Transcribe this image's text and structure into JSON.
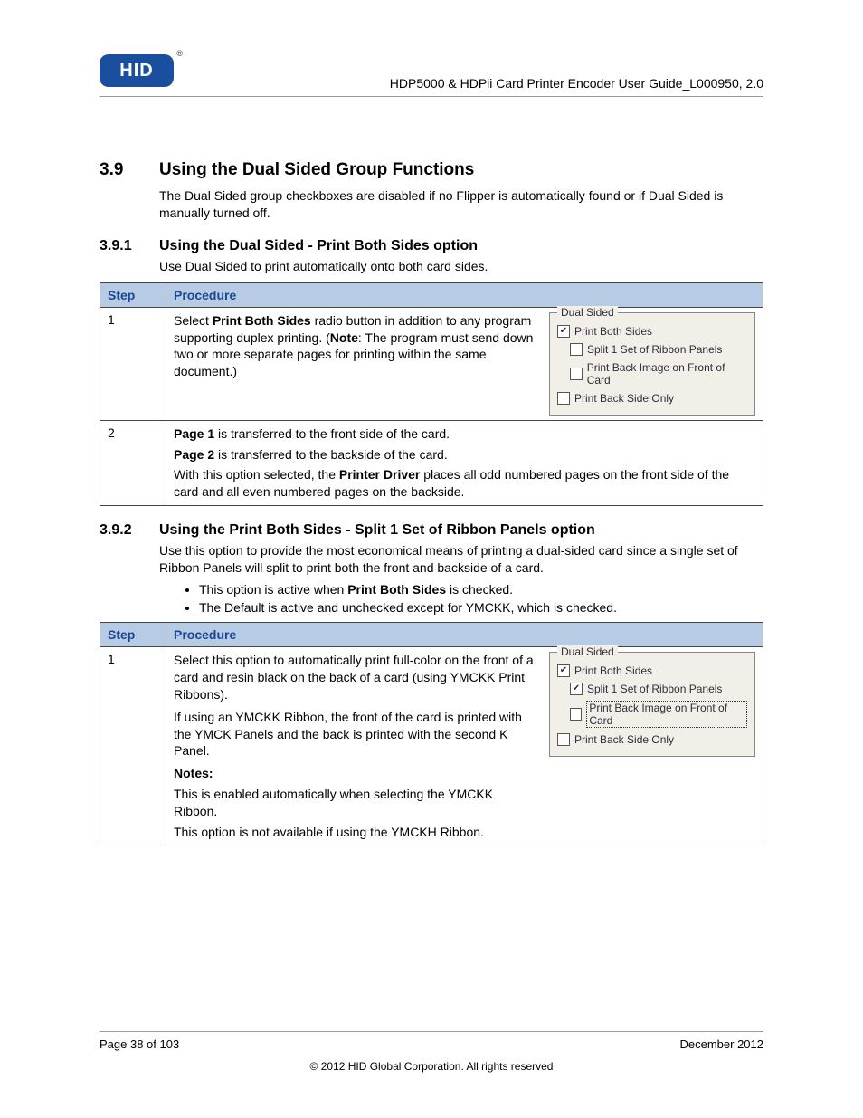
{
  "header": {
    "logo_text": "HID",
    "reg": "®",
    "doc_title": "HDP5000 & HDPii Card Printer Encoder User Guide_L000950, 2.0"
  },
  "section_39": {
    "num": "3.9",
    "title": "Using the Dual Sided Group Functions",
    "intro": "The Dual Sided group checkboxes are disabled if no Flipper is automatically found or if Dual Sided is manually turned off."
  },
  "section_391": {
    "num": "3.9.1",
    "title": "Using the Dual Sided - Print Both Sides option",
    "intro": "Use Dual Sided to print automatically onto both card sides.",
    "headers": {
      "step": "Step",
      "procedure": "Procedure"
    },
    "row1": {
      "step": "1",
      "text_pre": "Select ",
      "text_bold1": "Print Both Sides",
      "text_mid1": " radio button in addition to any program supporting duplex printing. (",
      "text_bold2": "Note",
      "text_mid2": ":  The program must send down two or more separate pages for printing within the same document.)"
    },
    "gb1": {
      "legend": "Dual Sided",
      "opt1": "Print Both Sides",
      "opt2": "Split 1 Set of Ribbon Panels",
      "opt3": "Print Back Image on Front of Card",
      "opt4": "Print Back Side Only"
    },
    "row2": {
      "step": "2",
      "line1_b": "Page 1",
      "line1_t": " is transferred to the front side of the card.",
      "line2_b": "Page 2",
      "line2_t": " is transferred to the backside of the card.",
      "line3_a": "With this option selected, the ",
      "line3_b": "Printer Driver",
      "line3_c": " places all odd numbered pages on the front side of the card and all even numbered pages on the backside."
    }
  },
  "section_392": {
    "num": "3.9.2",
    "title": "Using the Print Both Sides - Split 1 Set of Ribbon Panels option",
    "intro": "Use this option to provide the most economical means of printing a dual-sided card since a single set of Ribbon Panels will split to print both the front and backside of a card.",
    "bullet1_a": "This option is active when ",
    "bullet1_b": "Print Both Sides",
    "bullet1_c": " is checked.",
    "bullet2": "The Default is active and unchecked except for YMCKK, which is checked.",
    "headers": {
      "step": "Step",
      "procedure": "Procedure"
    },
    "row1": {
      "step": "1",
      "p1": "Select this option to automatically print full-color on the front of a card and resin black on the back of a card (using YMCKK Print Ribbons).",
      "p2": "If using an YMCKK Ribbon, the front of the card is printed with the YMCK Panels and the back is printed with the second K Panel.",
      "notes_label": "Notes:",
      "n1": "This is enabled automatically when selecting the YMCKK Ribbon.",
      "n2": "This option is not available if using the YMCKH Ribbon."
    },
    "gb2": {
      "legend": "Dual Sided",
      "opt1": "Print Both Sides",
      "opt2": "Split 1 Set of Ribbon Panels",
      "opt3": "Print Back Image on Front of Card",
      "opt4": "Print Back Side Only"
    }
  },
  "footer": {
    "left": "Page 38 of 103",
    "right": "December 2012",
    "center": "© 2012 HID Global Corporation. All rights reserved"
  }
}
